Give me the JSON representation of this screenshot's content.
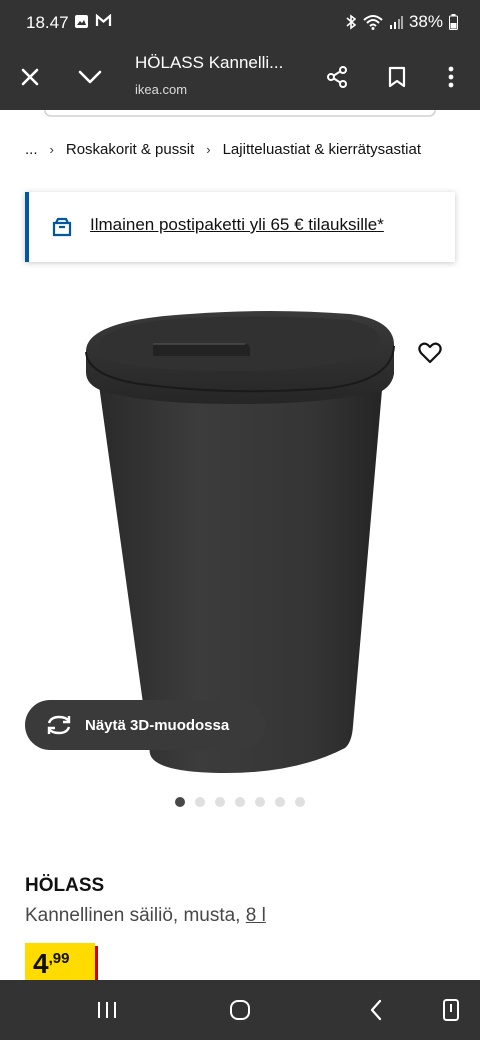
{
  "status_bar": {
    "time": "18.47",
    "battery": "38%",
    "left_icons": [
      "gallery-icon",
      "gmail-icon"
    ],
    "right_icons": [
      "bluetooth-icon",
      "wifi-icon",
      "signal-icon",
      "battery-icon"
    ]
  },
  "browser": {
    "page_title": "HÖLASS Kannelli...",
    "domain": "ikea.com",
    "close_icon": "close-icon",
    "collapse_icon": "chevron-down-icon",
    "share_icon": "share-icon",
    "bookmark_icon": "bookmark-icon",
    "menu_icon": "more-vert-icon"
  },
  "breadcrumb": {
    "ellipsis": "...",
    "items": [
      "Roskakorit & pussit",
      "Lajitteluastiat & kierrätysastiat"
    ]
  },
  "promo": {
    "text": "Ilmainen postipaketti yli 65 € tilauksille*",
    "icon": "parcel-box-icon",
    "accent": "#0058a3"
  },
  "gallery": {
    "button_3d_label": "Näytä 3D-muodossa",
    "button_3d_icon": "rotate-3d-icon",
    "active_image": 1,
    "image_count": 7
  },
  "product": {
    "name": "HÖLASS",
    "description": "Kannellinen säiliö, musta,",
    "size": "8 l",
    "price_integer": "4",
    "price_decimal": ",99",
    "price_bg": "#ffdb00",
    "price_shadow": "#cc0008"
  },
  "nav_bar": {
    "recents_icon": "recents-icon",
    "home_icon": "home-icon",
    "back_icon": "back-icon",
    "rotate_icon": "screen-rotate-icon"
  }
}
